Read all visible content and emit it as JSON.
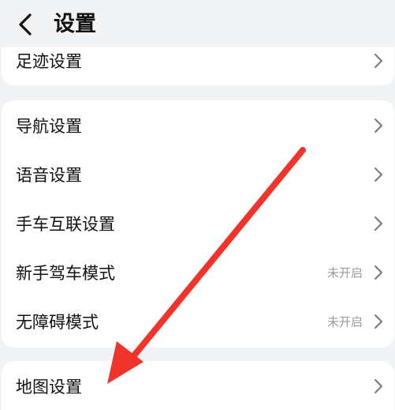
{
  "header": {
    "title": "设置",
    "back_icon": "chevron-left-icon"
  },
  "groups": [
    {
      "items": [
        {
          "label": "足迹设置",
          "value": ""
        }
      ]
    },
    {
      "items": [
        {
          "label": "导航设置",
          "value": ""
        },
        {
          "label": "语音设置",
          "value": ""
        },
        {
          "label": "手车互联设置",
          "value": ""
        },
        {
          "label": "新手驾车模式",
          "value": "未开启"
        },
        {
          "label": "无障碍模式",
          "value": "未开启"
        }
      ]
    },
    {
      "items": [
        {
          "label": "地图设置",
          "value": ""
        }
      ]
    }
  ],
  "annotation": {
    "icon": "red-arrow-annotation-icon",
    "color": "#f0342c"
  },
  "colors": {
    "background": "#f1f3f5",
    "card": "#ffffff",
    "text": "#111111",
    "secondary_text": "#9a9a9a",
    "chevron": "#777777"
  }
}
